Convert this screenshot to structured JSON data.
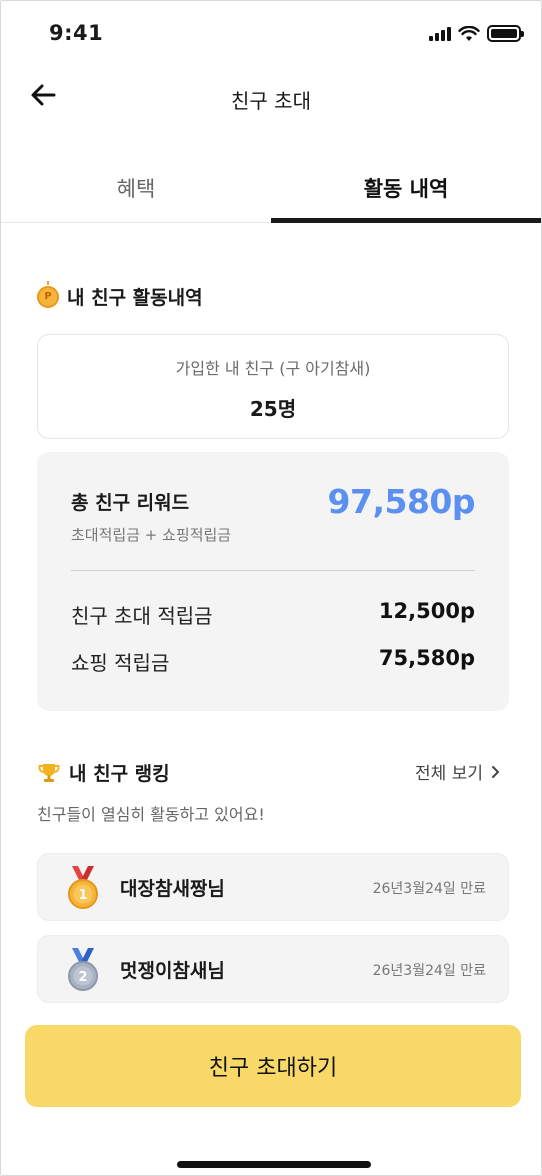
{
  "status_bar": {
    "time": "9:41"
  },
  "header": {
    "title": "친구 초대",
    "back_icon": "arrow-left-icon"
  },
  "tabs": [
    {
      "label": "혜택",
      "active": false
    },
    {
      "label": "활동 내역",
      "active": true
    }
  ],
  "activity": {
    "heading": "내 친구 활동내역",
    "joined_label": "가입한 내 친구 (구 아기참새)",
    "joined_count": "25명",
    "rewards": {
      "total_label": "총 친구 리워드",
      "total_sub": "초대적립금 + 쇼핑적립금",
      "total_value": "97,580p",
      "total_color": "#5b8ff0",
      "rows": [
        {
          "label": "친구 초대 적립금",
          "value": "12,500p"
        },
        {
          "label": "쇼핑 적립금",
          "value": "75,580p"
        }
      ]
    }
  },
  "ranking": {
    "heading": "내 친구 랭킹",
    "see_all": "전체 보기",
    "subtitle": "친구들이 열심히 활동하고 있어요!",
    "items": [
      {
        "rank": "1",
        "name": "대장참새짱님",
        "expiry": "26년3월24일 만료",
        "medal": "gold-medal-icon"
      },
      {
        "rank": "2",
        "name": "멋쟁이참새님",
        "expiry": "26년3월24일 만료",
        "medal": "silver-medal-icon"
      }
    ]
  },
  "cta": {
    "label": "친구 초대하기",
    "color": "#f8d968"
  }
}
